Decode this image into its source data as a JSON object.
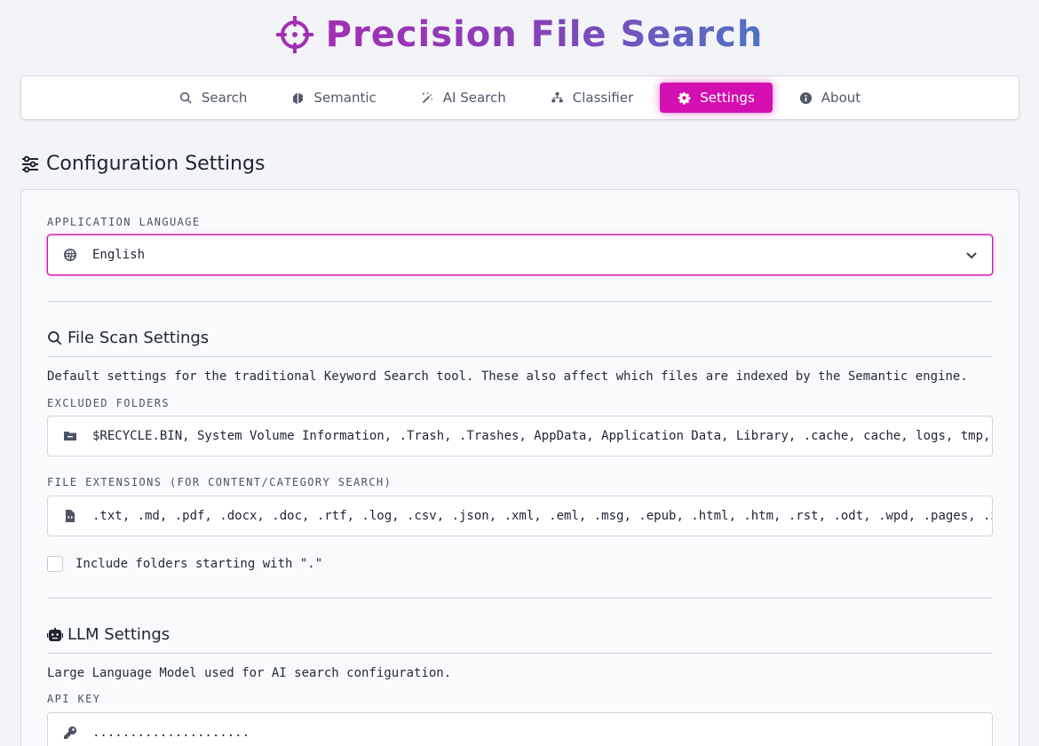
{
  "app": {
    "title": "Precision File Search",
    "accent_color": "#d40fb1",
    "title_gradient": [
      "#a22fb4",
      "#4f72c4"
    ],
    "logo_icon": "crosshair-icon"
  },
  "nav": {
    "tabs": [
      {
        "label": "Search",
        "icon": "search-icon",
        "active": false
      },
      {
        "label": "Semantic",
        "icon": "brain-icon",
        "active": false
      },
      {
        "label": "AI Search",
        "icon": "magic-wand-icon",
        "active": false
      },
      {
        "label": "Classifier",
        "icon": "sitemap-icon",
        "active": false
      },
      {
        "label": "Settings",
        "icon": "gear-icon",
        "active": true
      },
      {
        "label": "About",
        "icon": "info-icon",
        "active": false
      }
    ]
  },
  "page": {
    "heading": "Configuration Settings",
    "heading_icon": "sliders-icon"
  },
  "language": {
    "label": "APPLICATION LANGUAGE",
    "value": "English",
    "icon": "globe-icon"
  },
  "file_scan": {
    "heading": "File Scan Settings",
    "icon": "search-icon",
    "description": "Default settings for the traditional Keyword Search tool. These also affect which files are indexed by the Semantic engine.",
    "excluded_label": "EXCLUDED FOLDERS",
    "excluded_value": "$RECYCLE.BIN, System Volume Information, .Trash, .Trashes, AppData, Application Data, Library, .cache, cache, logs, tmp, temp, no",
    "extensions_label": "FILE EXTENSIONS (FOR CONTENT/CATEGORY SEARCH)",
    "extensions_value": ".txt, .md, .pdf, .docx, .doc, .rtf, .log, .csv, .json, .xml, .eml, .msg, .epub, .html, .htm, .rst, .odt, .wpd, .pages, .xlsx, .xl",
    "include_dot_label": "Include folders starting with \".\"",
    "include_dot_checked": false
  },
  "llm": {
    "heading": "LLM Settings",
    "icon": "robot-icon",
    "description": "Large Language Model used for AI search configuration.",
    "api_key_label": "API KEY",
    "api_key_value": "....................."
  }
}
